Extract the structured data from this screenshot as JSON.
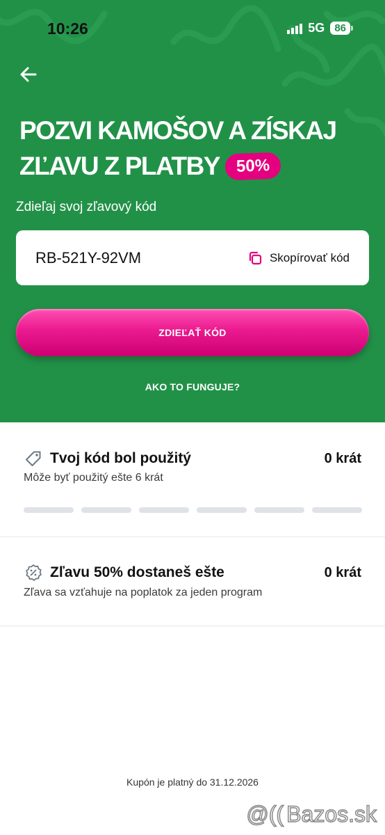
{
  "status_bar": {
    "time": "10:26",
    "network": "5G",
    "battery": "86"
  },
  "header": {
    "title_line1": "POZVI KAMOŠOV A ZÍSKAJ",
    "title_line2": "ZĽAVU Z PLATBY",
    "badge": "50%"
  },
  "share": {
    "label": "Zdieľaj svoj zľavový kód",
    "code": "RB-521Y-92VM",
    "copy_label": "Skopírovať kód",
    "share_button": "ZDIEĽAŤ KÓD",
    "how_link": "AKO TO FUNGUJE?"
  },
  "usage": {
    "title": "Tvoj kód bol použitý",
    "count": "0 krát",
    "subtitle": "Môže byť použitý ešte 6 krát",
    "segments_total": 6,
    "segments_filled": 0
  },
  "discount": {
    "title": "Zľavu 50% dostaneš ešte",
    "count": "0 krát",
    "subtitle": "Zľava sa vzťahuje na poplatok za jeden program"
  },
  "footer": {
    "validity": "Kupón je platný do 31.12.2026"
  },
  "watermark": {
    "text": "Bazos.sk"
  },
  "colors": {
    "hero_green": "#229148",
    "accent_magenta": "#e4007f"
  }
}
